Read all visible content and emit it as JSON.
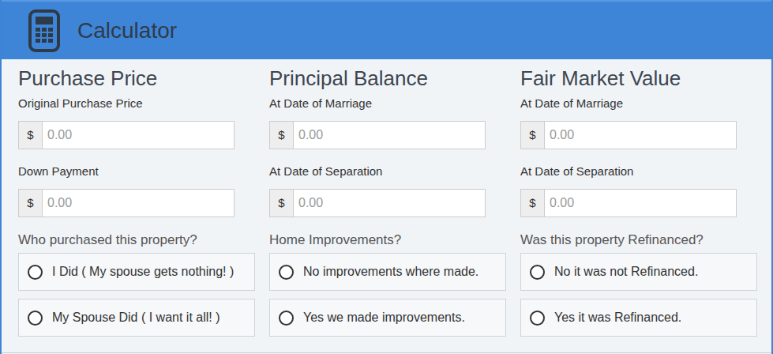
{
  "header": {
    "title": "Calculator"
  },
  "columns": [
    {
      "title": "Purchase Price",
      "fields": [
        {
          "label": "Original Purchase Price",
          "prefix": "$",
          "placeholder": "0.00"
        },
        {
          "label": "Down Payment",
          "prefix": "$",
          "placeholder": "0.00"
        }
      ],
      "question": {
        "label": "Who purchased this property?",
        "options": [
          {
            "label": "I Did ( My spouse gets nothing! )",
            "selected": false
          },
          {
            "label": "My Spouse Did ( I want it all! )",
            "selected": false
          }
        ]
      }
    },
    {
      "title": "Principal Balance",
      "fields": [
        {
          "label": "At Date of Marriage",
          "prefix": "$",
          "placeholder": "0.00"
        },
        {
          "label": "At Date of Separation",
          "prefix": "$",
          "placeholder": "0.00"
        }
      ],
      "question": {
        "label": "Home Improvements?",
        "options": [
          {
            "label": "No improvements where made.",
            "selected": false
          },
          {
            "label": "Yes we made improvements.",
            "selected": false
          }
        ]
      }
    },
    {
      "title": "Fair Market Value",
      "fields": [
        {
          "label": "At Date of Marriage",
          "prefix": "$",
          "placeholder": "0.00"
        },
        {
          "label": "At Date of Separation",
          "prefix": "$",
          "placeholder": "0.00"
        }
      ],
      "question": {
        "label": "Was this property Refinanced?",
        "options": [
          {
            "label": "No it was not Refinanced.",
            "selected": false
          },
          {
            "label": "Yes it was Refinanced.",
            "selected": false
          }
        ]
      }
    }
  ]
}
